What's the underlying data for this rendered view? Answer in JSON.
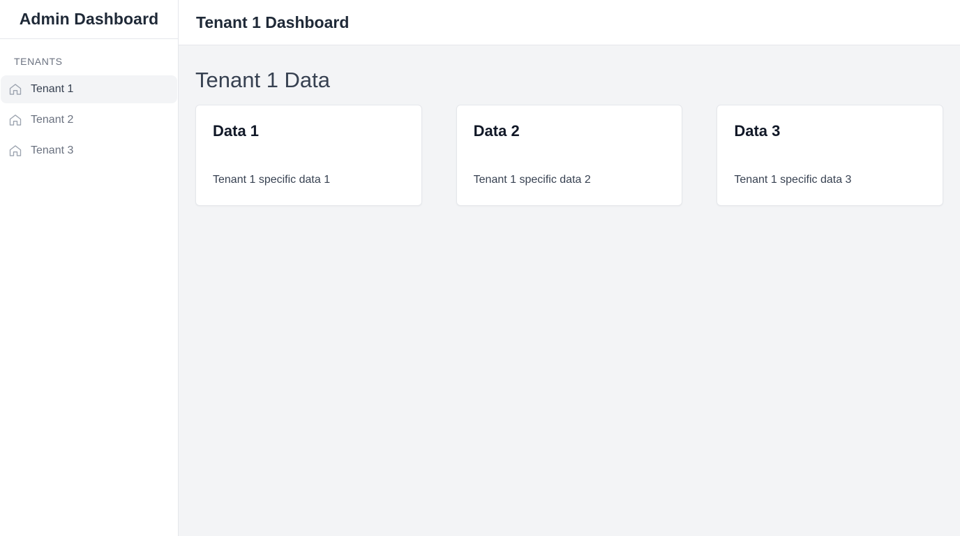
{
  "sidebar": {
    "title": "Admin Dashboard",
    "section_label": "TENANTS",
    "items": [
      {
        "label": "Tenant 1",
        "icon": "home-icon",
        "active": true
      },
      {
        "label": "Tenant 2",
        "icon": "home-icon",
        "active": false
      },
      {
        "label": "Tenant 3",
        "icon": "home-icon",
        "active": false
      }
    ]
  },
  "header": {
    "title": "Tenant 1 Dashboard"
  },
  "main": {
    "heading": "Tenant 1 Data",
    "cards": [
      {
        "title": "Data 1",
        "text": "Tenant 1 specific data 1"
      },
      {
        "title": "Data 2",
        "text": "Tenant 1 specific data 2"
      },
      {
        "title": "Data 3",
        "text": "Tenant 1 specific data 3"
      }
    ]
  },
  "colors": {
    "sidebar_bg": "#ffffff",
    "main_bg": "#f3f4f6",
    "active_item_bg": "#f3f4f6",
    "border": "#e5e7eb",
    "text_dark": "#1f2937",
    "text_muted": "#6b7280"
  }
}
